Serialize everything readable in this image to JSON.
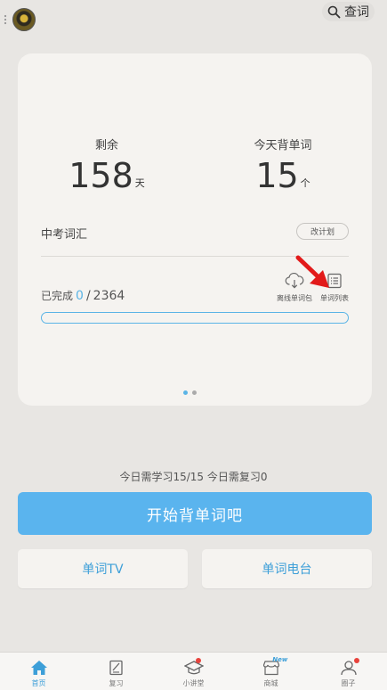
{
  "header": {
    "lookup_label": "查词",
    "search_icon": "search-icon"
  },
  "stats": {
    "remaining_caption": "剩余",
    "remaining_value": "158",
    "remaining_unit": "天",
    "today_caption": "今天背单词",
    "today_value": "15",
    "today_unit": "个"
  },
  "plan": {
    "name": "中考词汇",
    "change_label": "改计划"
  },
  "progress": {
    "done_label": "已完成",
    "done_count": "0",
    "separator": "/",
    "total": "2364",
    "fraction": 0
  },
  "tools": [
    {
      "label": "离线单词包",
      "icon": "cloud-download-icon"
    },
    {
      "label": "单词列表",
      "icon": "list-icon"
    }
  ],
  "pager": {
    "count": 2,
    "active": 0
  },
  "today_summary": "今日需学习15/15   今日需复习0",
  "buttons": {
    "start": "开始背单词吧",
    "tv": "单词TV",
    "radio": "单词电台"
  },
  "tabs": [
    {
      "label": "首页",
      "icon": "home-icon",
      "active": true
    },
    {
      "label": "复习",
      "icon": "review-icon"
    },
    {
      "label": "小讲堂",
      "icon": "graduation-cap-icon",
      "badge": "dot"
    },
    {
      "label": "商城",
      "icon": "store-icon",
      "badge": "New"
    },
    {
      "label": "圈子",
      "icon": "people-icon",
      "badge": "dot"
    }
  ],
  "colors": {
    "accent": "#5ab4ee",
    "background": "#e8e6e3",
    "card": "#f5f3f0",
    "badge": "#e8423b"
  }
}
